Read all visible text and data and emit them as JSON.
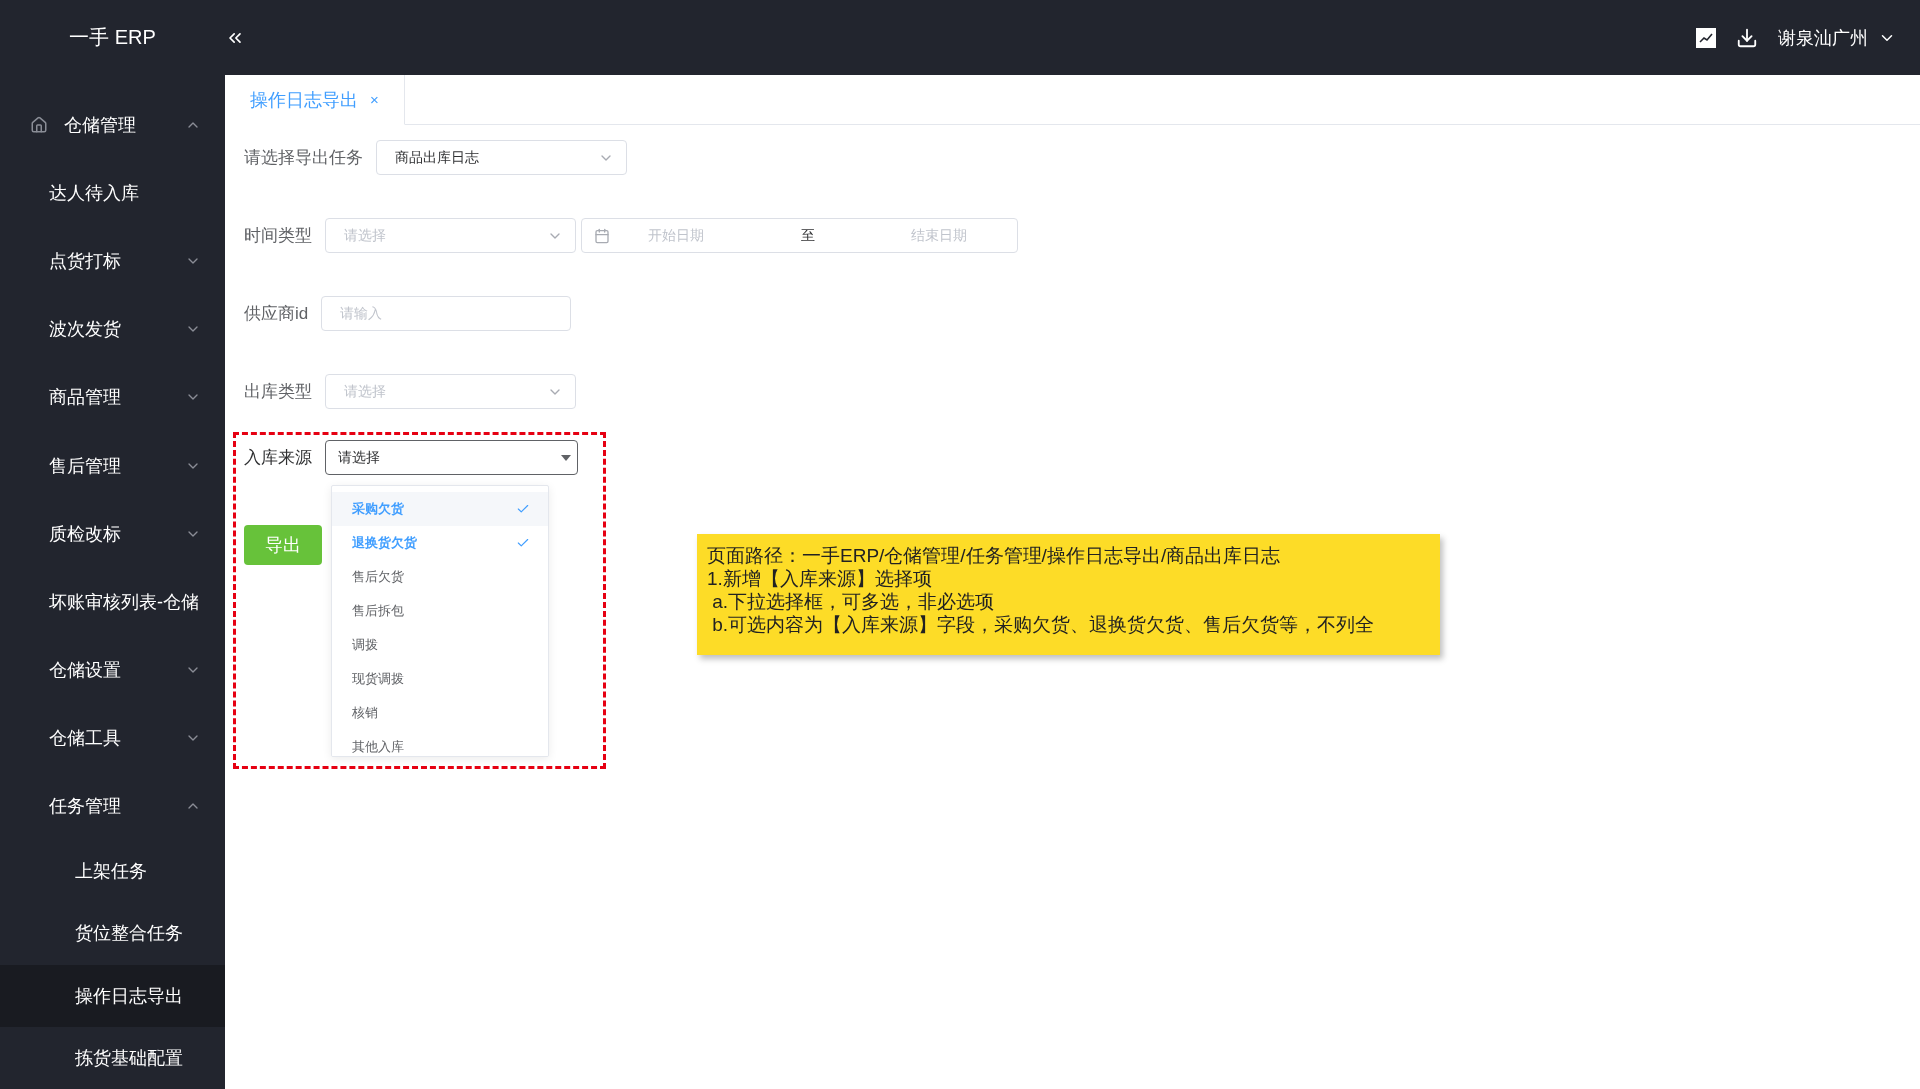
{
  "topbar": {
    "logo": "一手 ERP",
    "user": "谢泉汕广州"
  },
  "sidebar": {
    "items": [
      {
        "label": "仓储管理",
        "expanded": true,
        "children": [
          {
            "label": "达人待入库",
            "selected": false
          },
          {
            "label": "点货打标",
            "expanded": false
          },
          {
            "label": "波次发货",
            "expanded": false
          },
          {
            "label": "商品管理",
            "expanded": false
          },
          {
            "label": "售后管理",
            "expanded": false
          },
          {
            "label": "质检改标",
            "expanded": false
          },
          {
            "label": "坏账审核列表-仓储",
            "selected": false
          },
          {
            "label": "仓储设置",
            "expanded": false
          },
          {
            "label": "仓储工具",
            "expanded": false
          },
          {
            "label": "任务管理",
            "expanded": true,
            "children": [
              {
                "label": "上架任务",
                "selected": false
              },
              {
                "label": "货位整合任务",
                "selected": false
              },
              {
                "label": "操作日志导出",
                "selected": true
              },
              {
                "label": "拣货基础配置",
                "selected": false
              }
            ]
          }
        ]
      }
    ]
  },
  "tabs": [
    {
      "label": "操作日志导出",
      "selected": true,
      "close": "×"
    }
  ],
  "form": {
    "rows": [
      {
        "kind": "select",
        "label": "请选择导出任务",
        "value": "商品出库日志"
      },
      {
        "kind": "select",
        "label": "时间类型",
        "placeholder": "请选择",
        "range": {
          "start_placeholder": "开始日期",
          "separator": "至",
          "end_placeholder": "结束日期"
        }
      },
      {
        "kind": "input",
        "label": "供应商id",
        "placeholder": "请输入"
      },
      {
        "kind": "select",
        "label": "出库类型",
        "placeholder": "请选择"
      }
    ],
    "source": {
      "label": "入库来源",
      "value": "请选择",
      "options": [
        {
          "label": "采购欠货",
          "selected": true
        },
        {
          "label": "退换货欠货",
          "selected": true
        },
        {
          "label": "售后欠货",
          "selected": false
        },
        {
          "label": "售后拆包",
          "selected": false
        },
        {
          "label": "调拨",
          "selected": false
        },
        {
          "label": "现货调拨",
          "selected": false
        },
        {
          "label": "核销",
          "selected": false
        },
        {
          "label": "其他入库",
          "selected": false
        }
      ]
    },
    "export_button": "导出"
  },
  "note": {
    "lines": [
      "页面路径：一手ERP/仓储管理/任务管理/操作日志导出/商品出库日志",
      "1.新增【入库来源】选择项",
      " a.下拉选择框，可多选，非必选项",
      " b.可选内容为【入库来源】字段，采购欠货、退换货欠货、售后欠货等，不列全"
    ]
  }
}
